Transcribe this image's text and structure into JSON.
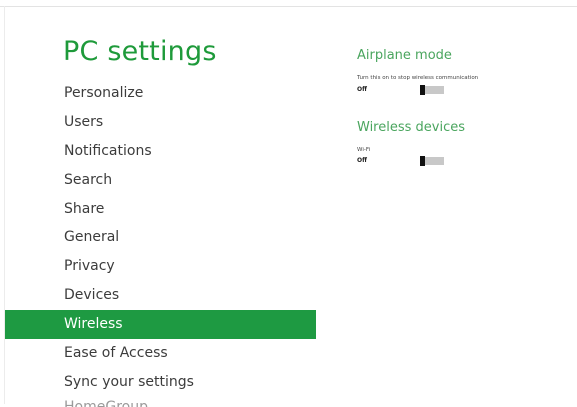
{
  "header": {
    "title": "PC settings"
  },
  "nav": {
    "items": [
      {
        "label": "Personalize"
      },
      {
        "label": "Users"
      },
      {
        "label": "Notifications"
      },
      {
        "label": "Search"
      },
      {
        "label": "Share"
      },
      {
        "label": "General"
      },
      {
        "label": "Privacy"
      },
      {
        "label": "Devices"
      },
      {
        "label": "Wireless",
        "selected": true
      },
      {
        "label": "Ease of Access"
      },
      {
        "label": "Sync your settings"
      },
      {
        "label": "HomeGroup"
      }
    ]
  },
  "airplane": {
    "title": "Airplane mode",
    "description": "Turn this on to stop wireless communication",
    "state": "Off",
    "toggle_on": false
  },
  "wireless": {
    "title": "Wireless devices",
    "device": "Wi-Fi",
    "state": "Off",
    "toggle_on": false
  },
  "colors": {
    "accent": "#1e9a42",
    "title": "#1e9a3a",
    "section_title": "#4aa55e",
    "toggle_track": "#c8c8c8",
    "toggle_thumb": "#111111"
  }
}
